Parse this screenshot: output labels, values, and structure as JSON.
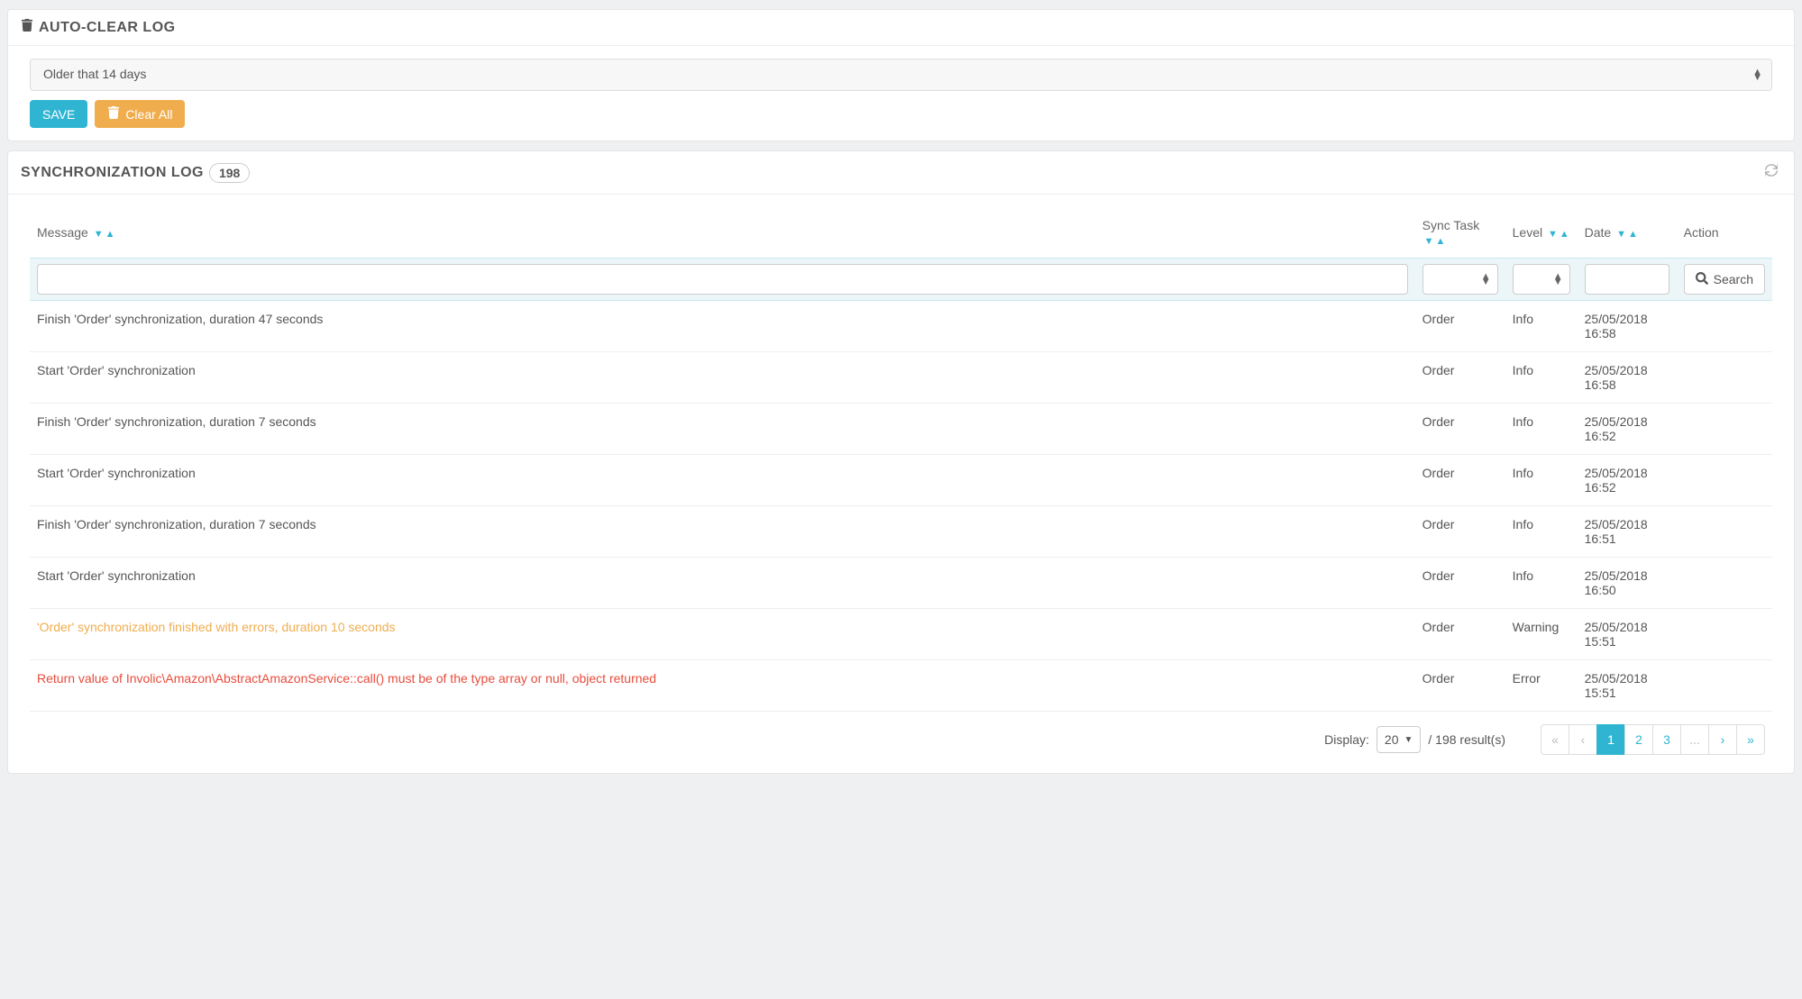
{
  "autoClear": {
    "title": "AUTO-CLEAR LOG",
    "selectValue": "Older that 14 days",
    "saveLabel": "SAVE",
    "clearAllLabel": "Clear All"
  },
  "syncLog": {
    "title": "SYNCHRONIZATION LOG",
    "count": "198",
    "columns": {
      "message": "Message",
      "syncTask": "Sync Task",
      "level": "Level",
      "date": "Date",
      "action": "Action"
    },
    "searchLabel": "Search",
    "rows": [
      {
        "msg": "Finish 'Order' synchronization, duration 47 seconds",
        "task": "Order",
        "level": "Info",
        "date": "25/05/2018 16:58",
        "cls": ""
      },
      {
        "msg": "Start 'Order' synchronization",
        "task": "Order",
        "level": "Info",
        "date": "25/05/2018 16:58",
        "cls": ""
      },
      {
        "msg": "Finish 'Order' synchronization, duration 7 seconds",
        "task": "Order",
        "level": "Info",
        "date": "25/05/2018 16:52",
        "cls": ""
      },
      {
        "msg": "Start 'Order' synchronization",
        "task": "Order",
        "level": "Info",
        "date": "25/05/2018 16:52",
        "cls": ""
      },
      {
        "msg": "Finish 'Order' synchronization, duration 7 seconds",
        "task": "Order",
        "level": "Info",
        "date": "25/05/2018 16:51",
        "cls": ""
      },
      {
        "msg": "Start 'Order' synchronization",
        "task": "Order",
        "level": "Info",
        "date": "25/05/2018 16:50",
        "cls": ""
      },
      {
        "msg": "'Order' synchronization finished with errors, duration 10 seconds",
        "task": "Order",
        "level": "Warning",
        "date": "25/05/2018 15:51",
        "cls": "msg-warning"
      },
      {
        "msg": "Return value of Involic\\Amazon\\AbstractAmazonService::call() must be of the type array or null, object returned",
        "task": "Order",
        "level": "Error",
        "date": "25/05/2018 15:51",
        "cls": "msg-error"
      }
    ],
    "footer": {
      "displayLabel": "Display:",
      "perPage": "20",
      "resultsText": "/ 198 result(s)",
      "pages": [
        "1",
        "2",
        "3",
        "..."
      ]
    }
  }
}
